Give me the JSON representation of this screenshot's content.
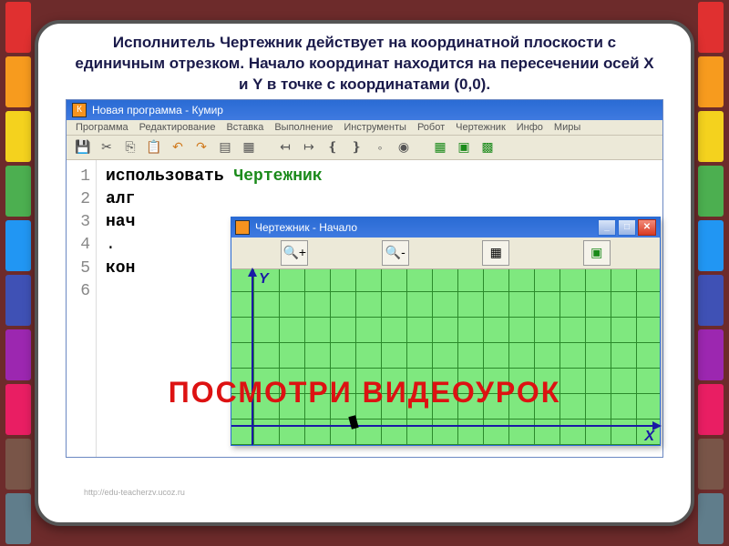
{
  "description": "Исполнитель Чертежник действует на координатной плоскости с единичным отрезком. Начало координат находится на пересечении осей X и Y в точке с координатами (0,0).",
  "ide": {
    "appIconLetter": "К",
    "title": "Новая программа - Кумир",
    "menu": [
      "Программа",
      "Редактирование",
      "Вставка",
      "Выполнение",
      "Инструменты",
      "Робот",
      "Чертежник",
      "Инфо",
      "Миры"
    ],
    "code": {
      "lines": [
        "1",
        "2",
        "3",
        "4",
        "5",
        "6"
      ],
      "l1_use": "использовать",
      "l1_name": "Чертежник",
      "l2": "алг",
      "l3": "нач",
      "l4": ".",
      "l5": "кон",
      "l6": ""
    }
  },
  "draftsman": {
    "title": "Чертежник - Начало",
    "ylabel": "Y",
    "xlabel": "X"
  },
  "overlay": "ПОСМОТРИ   ВИДЕОУРОК",
  "slide": "1",
  "srcurl": "http://edu-teacherzv.ucoz.ru",
  "crayonColors": [
    "#e03030",
    "#f79b1e",
    "#f4d21e",
    "#4caf50",
    "#2196f3",
    "#3f51b5",
    "#9c27b0",
    "#e91e63",
    "#795548",
    "#607d8b"
  ]
}
